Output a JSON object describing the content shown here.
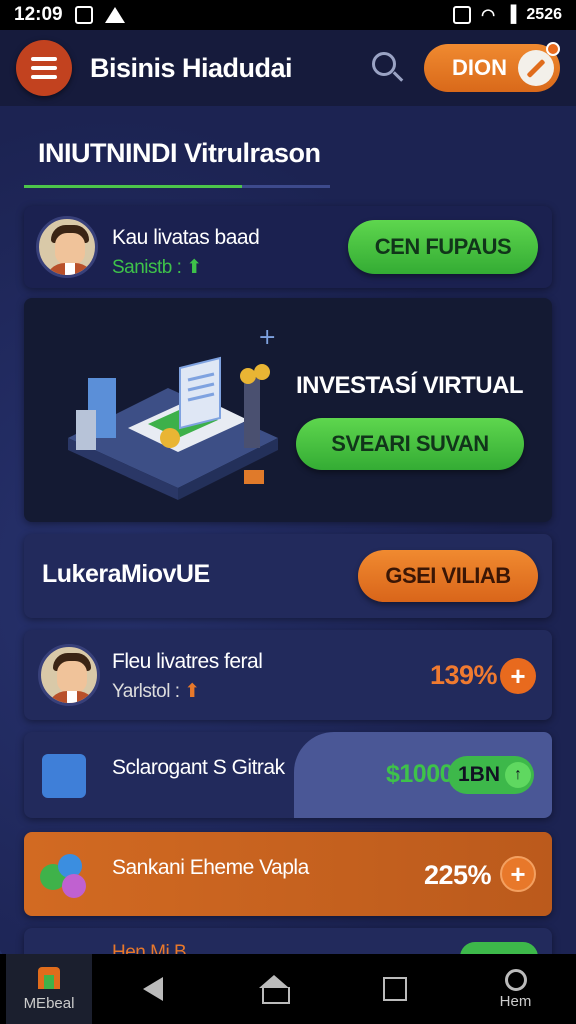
{
  "status_bar": {
    "time": "12:09",
    "right_text": "2526"
  },
  "app_bar": {
    "title": "Bisinis Hiadudai",
    "action_label": "DION"
  },
  "section": {
    "title": "INIUTNINDI Vitrulrason"
  },
  "profile_card": {
    "name": "Kau livatas baad",
    "subtitle": "Sanistb :",
    "button_label": "CEN FUPAUS"
  },
  "hero_card": {
    "title": "INVESTASÍ VIRTUAL",
    "button_label": "SVEARI SUVAN"
  },
  "leaderboard": {
    "title": "LukeraMiovUE",
    "button_label": "GSEI VILIAB"
  },
  "list_items": [
    {
      "name": "Fleu livatres feral",
      "subtitle": "Yarlstol :",
      "value": "139%"
    },
    {
      "name": "Sclarogant S Gitrak",
      "value_left": "$1000",
      "value_badge": "1BN"
    },
    {
      "name": "Sankani Eheme Vapla",
      "value": "225%"
    },
    {
      "name": "Hen Mi B"
    }
  ],
  "nav": {
    "home_label": "MEbeal",
    "right_label": "Hem"
  },
  "colors": {
    "accent_green": "#4cc64a",
    "accent_orange": "#e86a1e",
    "background": "#1c2352"
  }
}
